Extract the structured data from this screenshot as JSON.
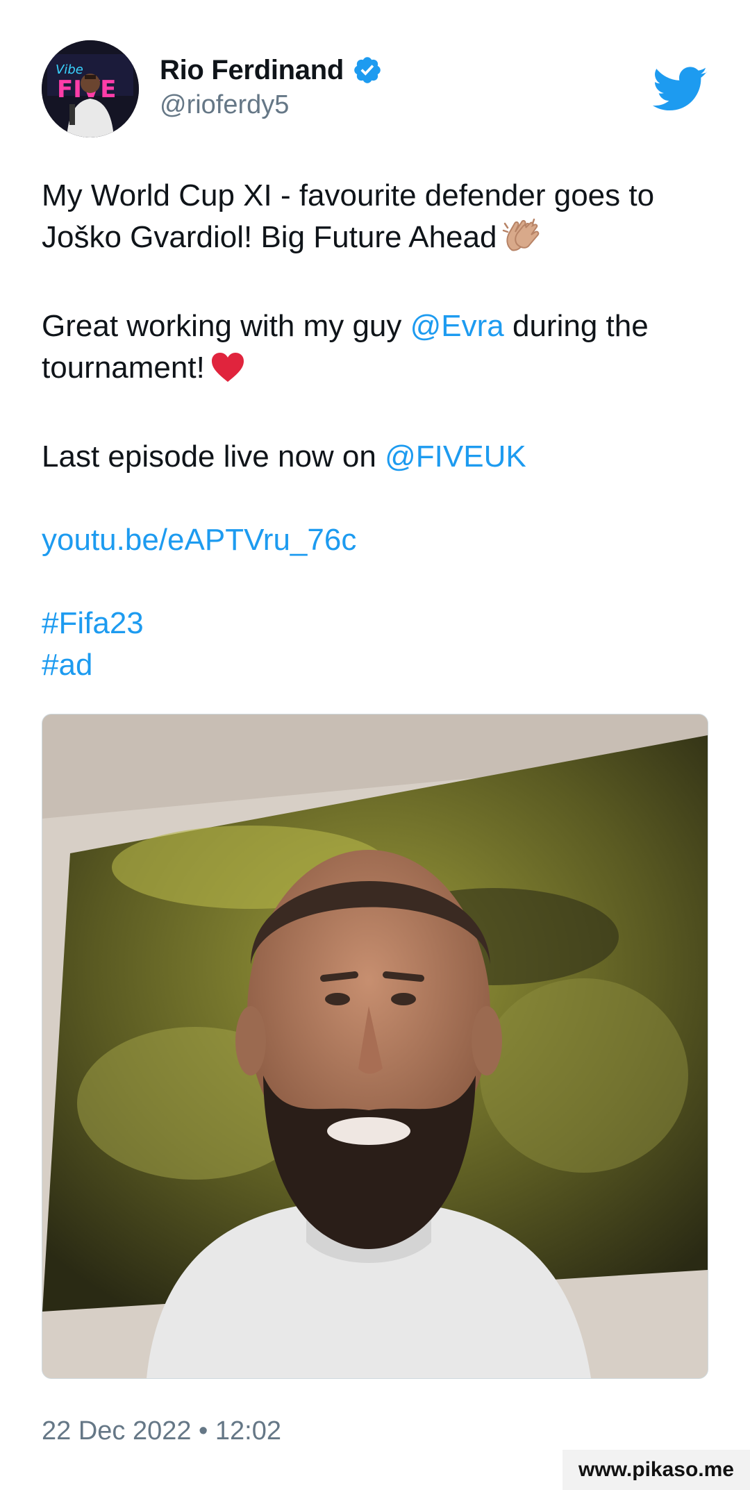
{
  "author": {
    "name": "Rio Ferdinand",
    "handle": "@rioferdy5",
    "verified": true,
    "avatar_icon": "profile-photo"
  },
  "brand": {
    "logo_icon": "twitter-bird-icon",
    "accent_color": "#1d9bf0"
  },
  "tweet": {
    "line1": "My World Cup XI - favourite defender goes to Joško Gvardiol! Big Future Ahead",
    "line1_emoji": "clapping-hands-emoji",
    "line2_prefix": "Great working with my guy ",
    "line2_mention": "@Evra",
    "line2_suffix": " during the tournament!",
    "line2_emoji": "red-heart-emoji",
    "line3_prefix": "Last episode live now on ",
    "line3_mention": "@FIVEUK",
    "link": "youtu.be/eAPTVru_76c",
    "hashtag1": "#Fifa23",
    "hashtag2": "#ad"
  },
  "media": {
    "type": "video-thumbnail"
  },
  "timestamp": "22 Dec 2022 • 12:02",
  "watermark": "www.pikaso.me"
}
